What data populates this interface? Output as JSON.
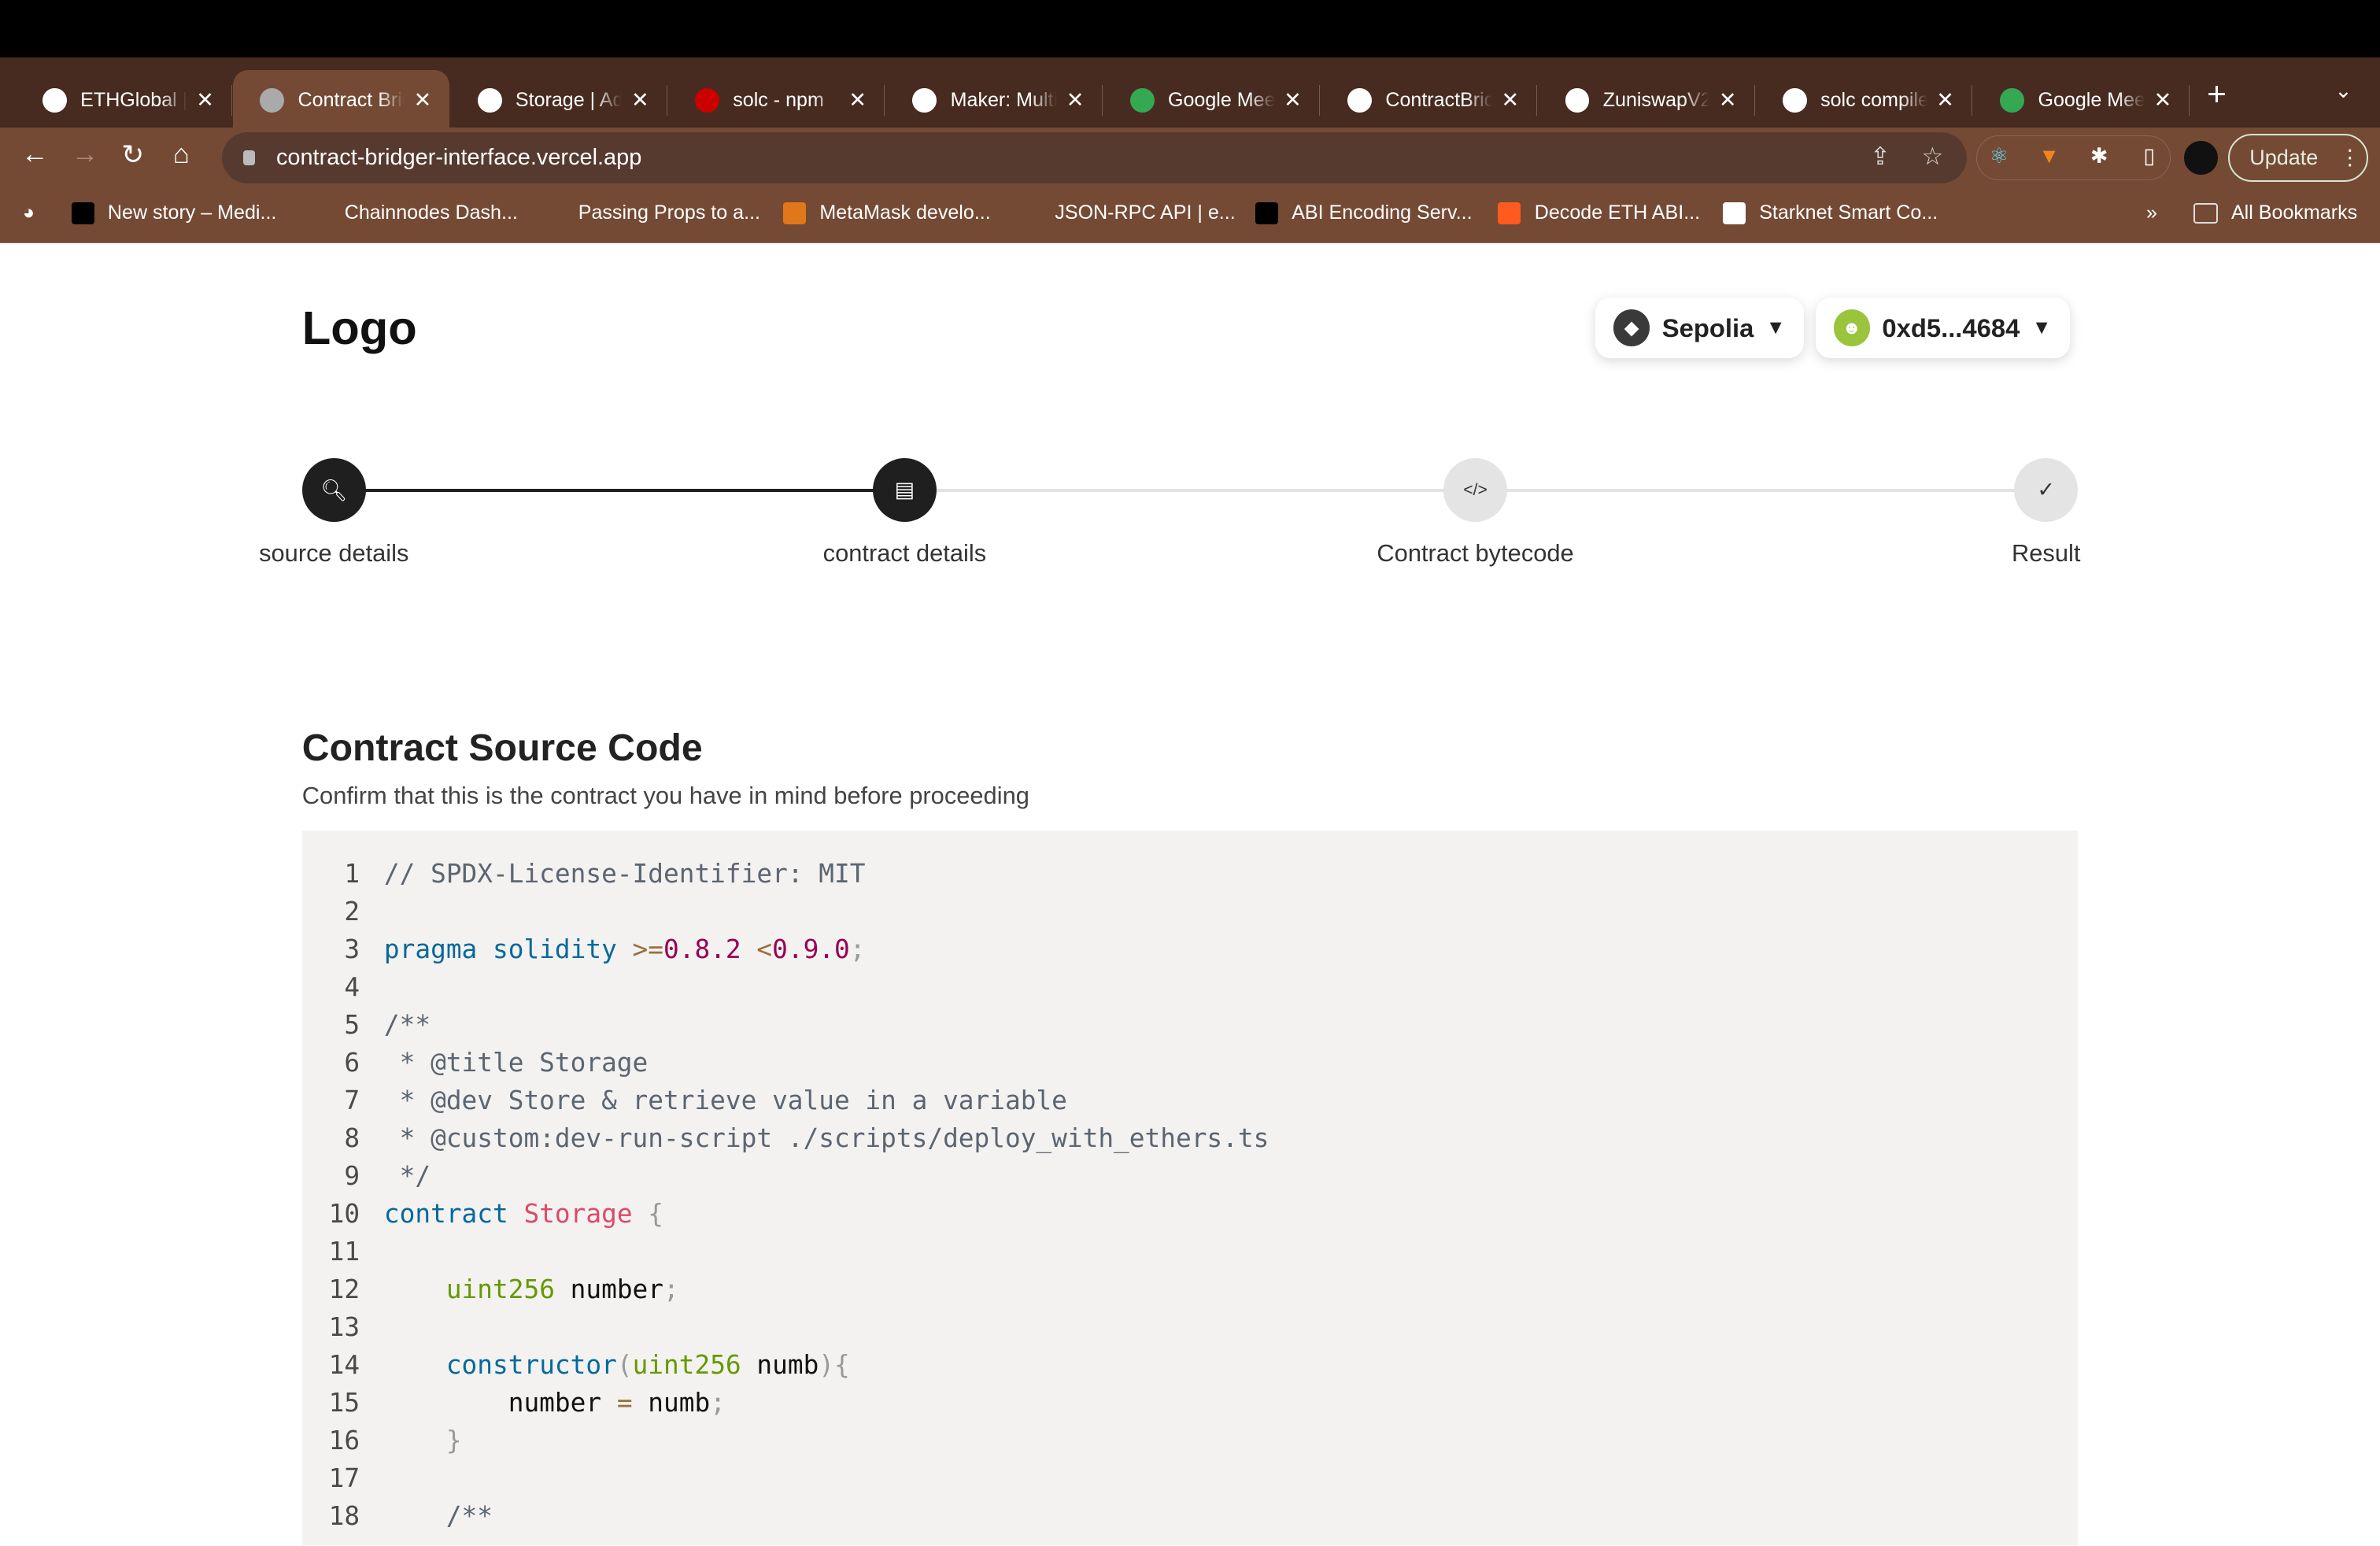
{
  "browser": {
    "tabs": [
      {
        "title": "ETHGlobal | ",
        "icon": "ethglobal-icon",
        "color": "#fff",
        "active": false
      },
      {
        "title": "Contract Bridger",
        "icon": "globe-icon",
        "color": "#aaa",
        "active": true
      },
      {
        "title": "Storage | Address",
        "icon": "etherscan-icon",
        "color": "#fff",
        "active": false
      },
      {
        "title": "solc - npm",
        "icon": "npm-icon",
        "color": "#cb0000",
        "active": false
      },
      {
        "title": "Maker: Multicall",
        "icon": "etherscan-icon",
        "color": "#fff",
        "active": false
      },
      {
        "title": "Google Meet",
        "icon": "google-meet-icon",
        "color": "#34a853",
        "active": false
      },
      {
        "title": "ContractBridger",
        "icon": "github-icon",
        "color": "#fff",
        "active": false
      },
      {
        "title": "ZuniswapV2",
        "icon": "etherscan-icon",
        "color": "#fff",
        "active": false
      },
      {
        "title": "solc compiler",
        "icon": "google-icon",
        "color": "#fff",
        "active": false
      },
      {
        "title": "Google Meet",
        "icon": "google-meet-icon",
        "color": "#34a853",
        "active": false
      }
    ],
    "url": "contract-bridger-interface.vercel.app",
    "update_label": "Update",
    "bookmarks": [
      {
        "label": "New story – Medi...",
        "icon": "medium-icon",
        "color": "#000"
      },
      {
        "label": "Chainnodes Dash...",
        "icon": "chainnodes-icon",
        "color": "transparent"
      },
      {
        "label": "Passing Props to a...",
        "icon": "react-icon",
        "color": "transparent"
      },
      {
        "label": "MetaMask develo...",
        "icon": "metamask-icon",
        "color": "#e2761b"
      },
      {
        "label": "JSON-RPC API | e...",
        "icon": "ethereum-icon",
        "color": "transparent"
      },
      {
        "label": "ABI Encoding Serv...",
        "icon": "hash-icon",
        "color": "#000"
      },
      {
        "label": "Decode ETH ABI...",
        "icon": "decode-icon",
        "color": "#ff5a1f"
      },
      {
        "label": "Starknet Smart Co...",
        "icon": "markdown-icon",
        "color": "#fff"
      }
    ],
    "more_bookmarks": "»",
    "all_bookmarks": "All Bookmarks"
  },
  "header": {
    "logo": "Logo",
    "network": "Sepolia",
    "account": "0xd5...4684"
  },
  "steps": [
    {
      "label": "source details",
      "status": "done",
      "icon": "file-search-icon"
    },
    {
      "label": "contract details",
      "status": "done",
      "icon": "file-chart-icon"
    },
    {
      "label": "Contract bytecode",
      "status": "todo",
      "icon": "code-icon"
    },
    {
      "label": "Result",
      "status": "todo",
      "icon": "file-check-icon"
    }
  ],
  "source": {
    "title": "Contract Source Code",
    "subtitle": "Confirm that this is the contract you have in mind before proceeding",
    "lines": [
      [
        {
          "t": "// SPDX-License-Identifier: MIT",
          "c": "comment"
        }
      ],
      [],
      [
        {
          "t": "pragma solidity ",
          "c": "keyword"
        },
        {
          "t": ">=",
          "c": "operator"
        },
        {
          "t": "0.8.2",
          "c": "number"
        },
        {
          "t": " ",
          "c": "plain"
        },
        {
          "t": "<",
          "c": "operator"
        },
        {
          "t": "0.9.0",
          "c": "number"
        },
        {
          "t": ";",
          "c": "punct"
        }
      ],
      [],
      [
        {
          "t": "/**",
          "c": "comment"
        }
      ],
      [
        {
          "t": " * @title Storage",
          "c": "comment"
        }
      ],
      [
        {
          "t": " * @dev Store & retrieve value in a variable",
          "c": "comment"
        }
      ],
      [
        {
          "t": " * @custom:dev-run-script ./scripts/deploy_with_ethers.ts",
          "c": "comment"
        }
      ],
      [
        {
          "t": " */",
          "c": "comment"
        }
      ],
      [
        {
          "t": "contract ",
          "c": "keyword"
        },
        {
          "t": "Storage",
          "c": "name"
        },
        {
          "t": " {",
          "c": "punct"
        }
      ],
      [],
      [
        {
          "t": "    ",
          "c": "plain"
        },
        {
          "t": "uint256",
          "c": "type"
        },
        {
          "t": " number",
          "c": "plain"
        },
        {
          "t": ";",
          "c": "punct"
        }
      ],
      [],
      [
        {
          "t": "    ",
          "c": "plain"
        },
        {
          "t": "constructor",
          "c": "keyword"
        },
        {
          "t": "(",
          "c": "punct"
        },
        {
          "t": "uint256",
          "c": "type"
        },
        {
          "t": " numb",
          "c": "plain"
        },
        {
          "t": "){",
          "c": "punct"
        }
      ],
      [
        {
          "t": "        number ",
          "c": "plain"
        },
        {
          "t": "=",
          "c": "operator"
        },
        {
          "t": " numb",
          "c": "plain"
        },
        {
          "t": ";",
          "c": "punct"
        }
      ],
      [
        {
          "t": "    }",
          "c": "punct"
        }
      ],
      [],
      [
        {
          "t": "    /**",
          "c": "comment"
        }
      ]
    ]
  }
}
